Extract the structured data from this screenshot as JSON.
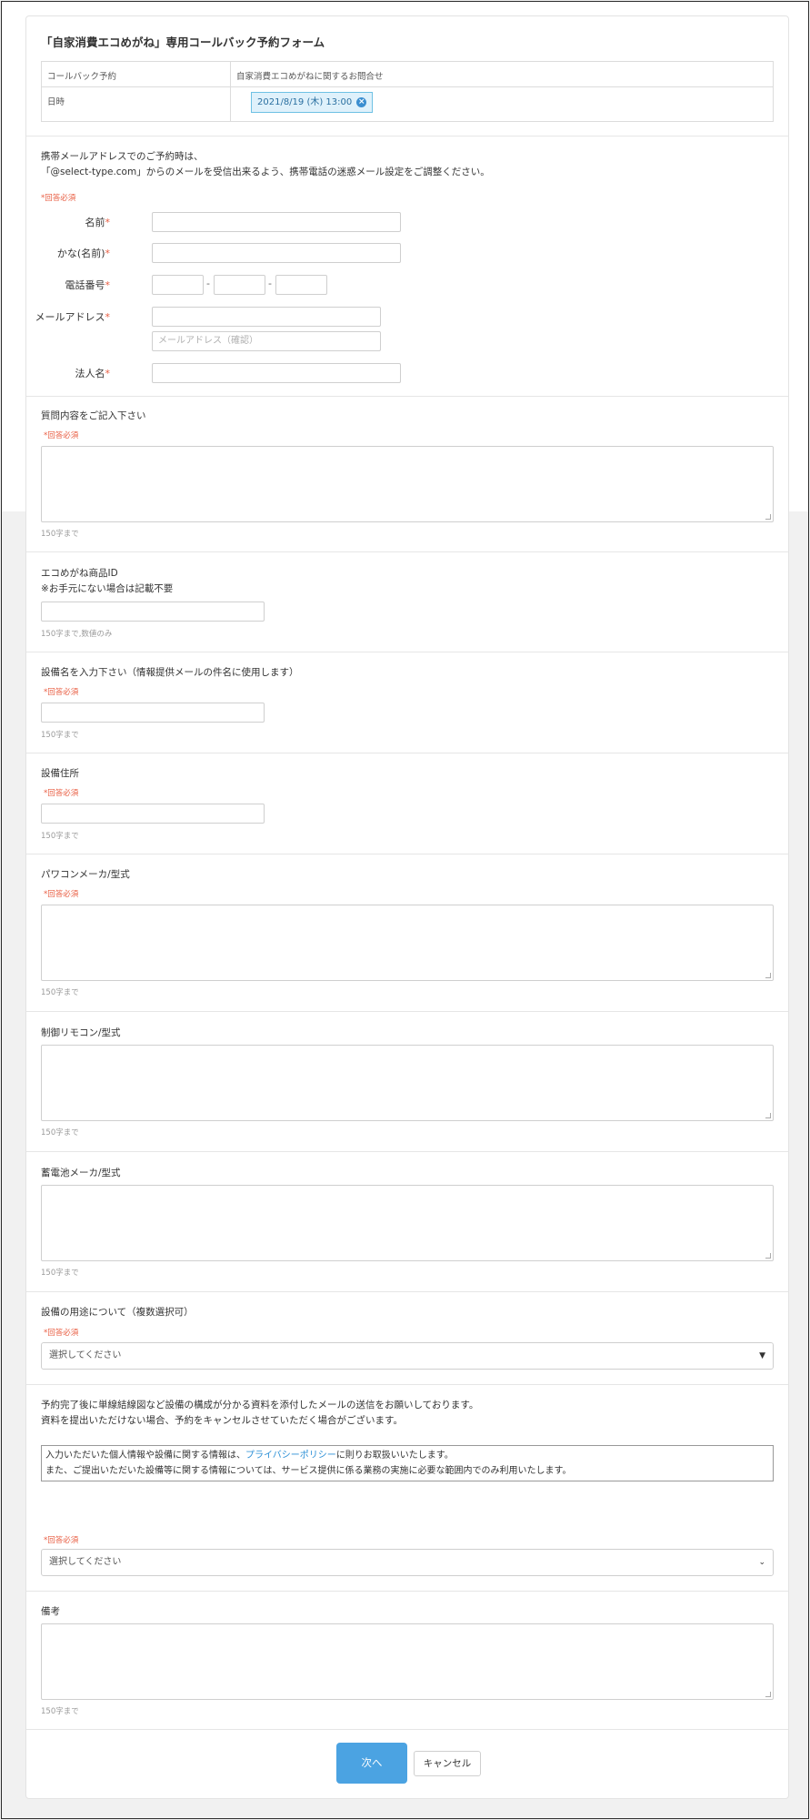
{
  "form": {
    "title": "「自家消費エコめがね」専用コールバック予約フォーム",
    "info": {
      "row1_label": "コールバック予約",
      "row1_value": "自家消費エコめがねに関するお問合せ",
      "row2_label": "日時",
      "date_value": "2021/8/19 (木) 13:00"
    },
    "notice_line1": "携帯メールアドレスでのご予約時は、",
    "notice_line2": "「@select-type.com」からのメールを受信出来るよう、携帯電話の迷惑メール設定をご調整ください。",
    "required_text": "*回答必須",
    "fields": {
      "name": "名前",
      "kana": "かな(名前)",
      "phone": "電話番号",
      "email": "メールアドレス",
      "email_confirm_placeholder": "メールアドレス（確認）",
      "company": "法人名",
      "star": "*"
    },
    "phone_sep": "-",
    "questions": {
      "q1": "質問内容をご記入下さい",
      "q2_line1": "エコめがね商品ID",
      "q2_line2": "※お手元にない場合は記載不要",
      "q3": "設備名を入力下さい（情報提供メールの件名に使用します）",
      "q4": "設備住所",
      "q5": "パワコンメーカ/型式",
      "q6": "制御リモコン/型式",
      "q7": "蓄電池メーカ/型式",
      "q8": "設備の用途について（複数選択可）",
      "q9": "備考"
    },
    "hints": {
      "h150": "150字まで",
      "h150num": "150字まで,数値のみ"
    },
    "select_placeholder": "選択してください",
    "attach_line1": "予約完了後に単線結線図など設備の構成が分かる資料を添付したメールの送信をお願いしております。",
    "attach_line2": "資料を提出いただけない場合、予約をキャンセルさせていただく場合がございます。",
    "policy_pre": "入力いただいた個人情報や設備に関する情報は、",
    "policy_link": "プライバシーポリシー",
    "policy_post": "に則りお取扱いいたします。",
    "policy_line2": "また、ご提出いただいた設備等に関する情報については、サービス提供に係る業務の実施に必要な範囲内でのみ利用いたします。",
    "buttons": {
      "next": "次へ",
      "cancel": "キャンセル"
    }
  }
}
